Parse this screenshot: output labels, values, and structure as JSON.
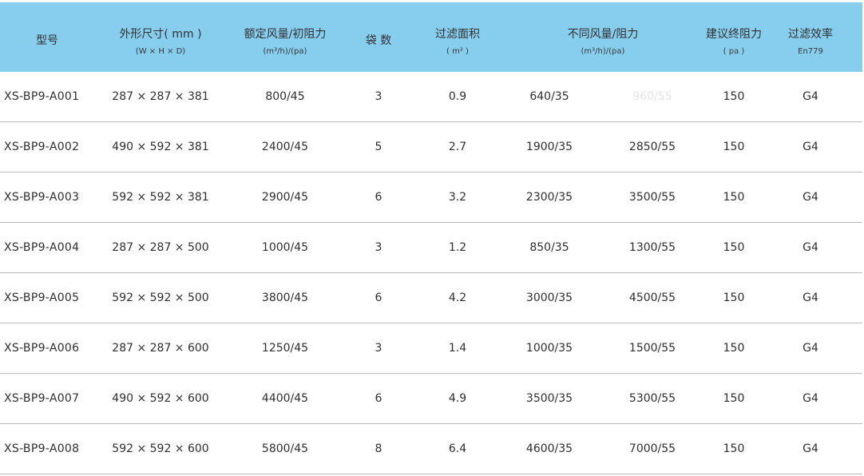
{
  "table": {
    "headers": {
      "model": {
        "main": "型号"
      },
      "size": {
        "main": "外形尺寸( mm )",
        "sub": "(W × H × D)"
      },
      "rated": {
        "main": "额定风量/初阻力",
        "sub": "(m³/h)/(pa)"
      },
      "bags": {
        "main": "袋  数"
      },
      "area": {
        "main": "过滤面积",
        "sub": "( m² )"
      },
      "flow": {
        "main": "不同风量/阻力",
        "sub": "(m³/h)/(pa)"
      },
      "final": {
        "main": "建议终阻力",
        "sub": "( pa )"
      },
      "eff": {
        "main": "过滤效率",
        "sub": "En779"
      }
    },
    "rows": [
      {
        "model": "XS-BP9-A001",
        "size": "287 × 287 × 381",
        "rated": "800/45",
        "bags": "3",
        "area": "0.9",
        "flow_a": "640/35",
        "flow_b": "960/55",
        "final": "150",
        "eff": "G4"
      },
      {
        "model": "XS-BP9-A002",
        "size": "490 × 592 × 381",
        "rated": "2400/45",
        "bags": "5",
        "area": "2.7",
        "flow_a": "1900/35",
        "flow_b": "2850/55",
        "final": "150",
        "eff": "G4"
      },
      {
        "model": "XS-BP9-A003",
        "size": "592 × 592 × 381",
        "rated": "2900/45",
        "bags": "6",
        "area": "3.2",
        "flow_a": "2300/35",
        "flow_b": "3500/55",
        "final": "150",
        "eff": "G4"
      },
      {
        "model": "XS-BP9-A004",
        "size": "287 × 287 × 500",
        "rated": "1000/45",
        "bags": "3",
        "area": "1.2",
        "flow_a": "850/35",
        "flow_b": "1300/55",
        "final": "150",
        "eff": "G4"
      },
      {
        "model": "XS-BP9-A005",
        "size": "592 × 592 × 500",
        "rated": "3800/45",
        "bags": "6",
        "area": "4.2",
        "flow_a": "3000/35",
        "flow_b": "4500/55",
        "final": "150",
        "eff": "G4"
      },
      {
        "model": "XS-BP9-A006",
        "size": "287 × 287 × 600",
        "rated": "1250/45",
        "bags": "3",
        "area": "1.4",
        "flow_a": "1000/35",
        "flow_b": "1500/55",
        "final": "150",
        "eff": "G4"
      },
      {
        "model": "XS-BP9-A007",
        "size": "490 × 592 × 600",
        "rated": "4400/45",
        "bags": "6",
        "area": "4.9",
        "flow_a": "3500/35",
        "flow_b": "5300/55",
        "final": "150",
        "eff": "G4"
      },
      {
        "model": "XS-BP9-A008",
        "size": "592 × 592 × 600",
        "rated": "5800/45",
        "bags": "8",
        "area": "6.4",
        "flow_a": "4600/35",
        "flow_b": "7000/55",
        "final": "150",
        "eff": "G4"
      }
    ]
  },
  "colors": {
    "header_bg": "#87cdee",
    "row_divider": "#b9b9b9",
    "text": "#2f2f2f"
  }
}
